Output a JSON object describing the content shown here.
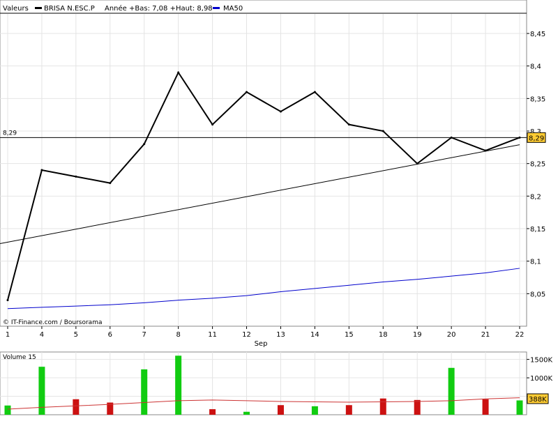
{
  "header": {
    "label": "Valeurs",
    "series_name": "BRISA N.ESC.P",
    "range_text": "Année +Bas: 7,08 +Haut: 8,98",
    "ma_name": "MA50"
  },
  "watermark": "© IT-Finance.com / Boursorama",
  "current_value_label": "8,29",
  "volume_panel": {
    "label": "Volume 15",
    "last_volume_label": "388K",
    "y_ticks": [
      "500K",
      "1000K",
      "1500K"
    ]
  },
  "colors": {
    "price": "#000000",
    "ma": "#0000cc",
    "up": "#11cc11",
    "down": "#cc1111",
    "badge": "#ffcc33",
    "volume_ma": "#cc3333"
  },
  "chart_data": [
    {
      "type": "line",
      "categories": [
        "1",
        "4",
        "5",
        "6",
        "7",
        "8",
        "11",
        "12",
        "13",
        "14",
        "15",
        "18",
        "19",
        "20",
        "21",
        "22"
      ],
      "xlabel": "Sep",
      "ylim": [
        8.0,
        8.48
      ],
      "y_ticks": [
        "8,05",
        "8,1",
        "8,15",
        "8,2",
        "8,25",
        "8,3",
        "8,35",
        "8,4",
        "8,45"
      ],
      "series": [
        {
          "name": "BRISA N.ESC.P",
          "values": [
            8.04,
            8.24,
            8.23,
            8.22,
            8.28,
            8.39,
            8.31,
            8.36,
            8.33,
            8.36,
            8.31,
            8.3,
            8.25,
            8.29,
            8.27,
            8.29
          ]
        },
        {
          "name": "MA50",
          "values": [
            8.027,
            8.029,
            8.031,
            8.033,
            8.036,
            8.04,
            8.043,
            8.047,
            8.053,
            8.058,
            8.063,
            8.068,
            8.072,
            8.077,
            8.082,
            8.089
          ]
        }
      ],
      "trend_line": {
        "start": 8.127,
        "end": 8.279
      },
      "reference_line": 8.29
    },
    {
      "type": "bar",
      "title": "Volume 15",
      "categories": [
        "1",
        "4",
        "5",
        "6",
        "7",
        "8",
        "11",
        "12",
        "13",
        "14",
        "15",
        "18",
        "19",
        "20",
        "21",
        "22"
      ],
      "values": [
        250000,
        1300000,
        420000,
        330000,
        1230000,
        1600000,
        150000,
        80000,
        260000,
        230000,
        260000,
        440000,
        400000,
        1270000,
        420000,
        388000
      ],
      "directions": [
        "up",
        "up",
        "down",
        "down",
        "up",
        "up",
        "down",
        "up",
        "down",
        "up",
        "down",
        "down",
        "down",
        "up",
        "down",
        "up"
      ],
      "moving_average": [
        150000,
        200000,
        240000,
        280000,
        330000,
        380000,
        400000,
        380000,
        360000,
        350000,
        340000,
        350000,
        360000,
        380000,
        430000,
        460000
      ],
      "ylim": [
        0,
        1700000
      ]
    }
  ]
}
